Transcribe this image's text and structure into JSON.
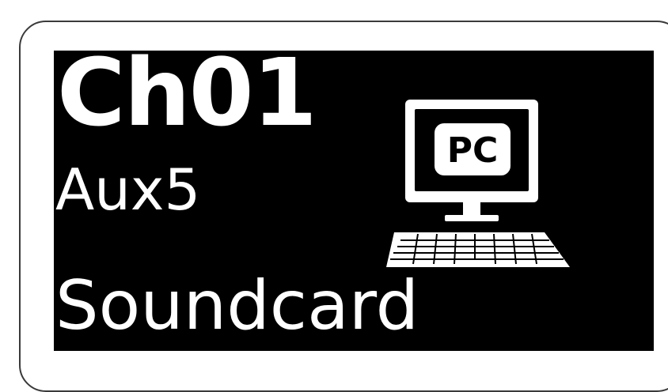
{
  "channel": {
    "id": "Ch01",
    "source": "Aux5",
    "device": "Soundcard"
  },
  "icon": {
    "name": "computer-icon",
    "label": "PC"
  },
  "colors": {
    "screen_background": "#000000",
    "text": "#ffffff",
    "frame_border": "#3a3a3a"
  }
}
